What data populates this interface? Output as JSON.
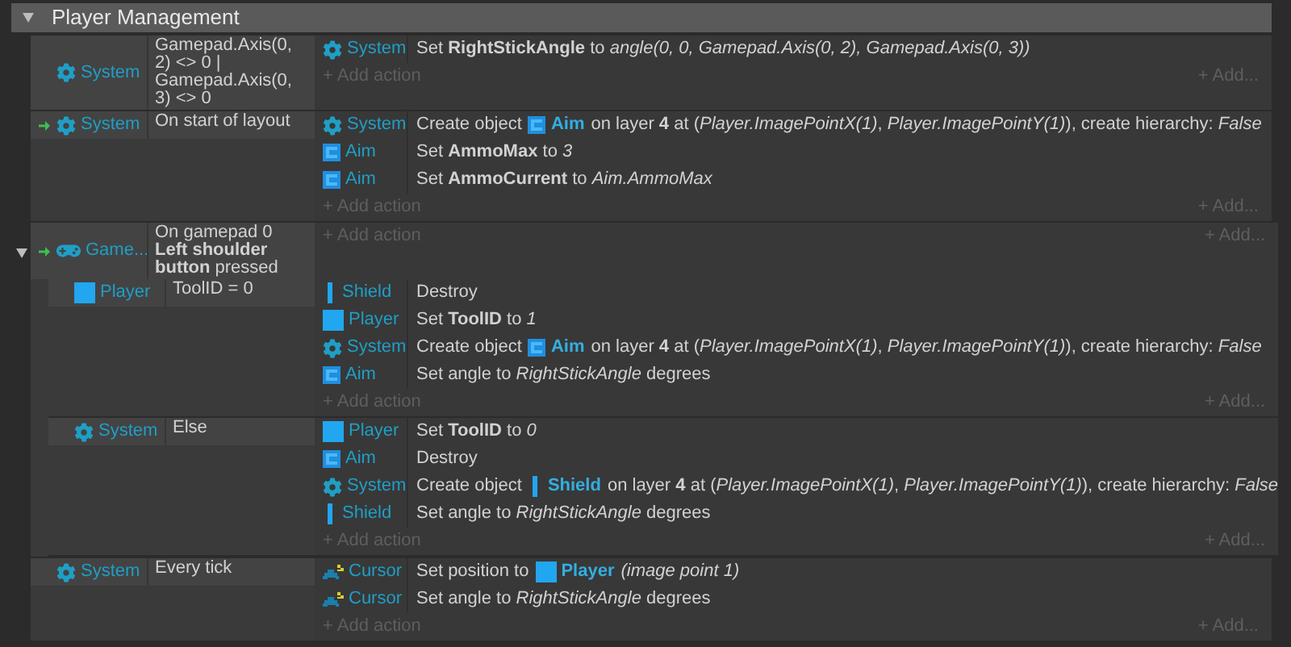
{
  "group": {
    "title": "Player Management",
    "expanded": true
  },
  "events": [
    {
      "trigger": false,
      "condition": {
        "kind": "gear",
        "object": "System",
        "text": "Gamepad.Axis(0, 2) <> 0 | Gamepad.Axis(0, 3) <> 0"
      },
      "actions": [
        {
          "kind": "gear",
          "object": "System",
          "parts": [
            {
              "kind": "text",
              "text": "Set **RightStickAngle** to *angle(0, 0, Gamepad.Axis(0, 2), Gamepad.Axis(0, 3))*"
            }
          ]
        }
      ],
      "add_action": "+ Add action",
      "add_more": "+ Add..."
    },
    {
      "trigger": true,
      "condition": {
        "kind": "gear",
        "object": "System",
        "text": "On start of layout"
      },
      "actions": [
        {
          "kind": "gear",
          "object": "System",
          "parts": [
            {
              "kind": "text",
              "text": "Create object"
            },
            {
              "kind": "aim",
              "text": "Aim"
            },
            {
              "kind": "text",
              "text": "on layer **4** at (*Player.ImagePointX(1)*, *Player.ImagePointY(1)*), create hierarchy: *False*"
            }
          ]
        },
        {
          "kind": "aim",
          "object": "Aim",
          "parts": [
            {
              "kind": "text",
              "text": "Set **AmmoMax** to *3*"
            }
          ]
        },
        {
          "kind": "aim",
          "object": "Aim",
          "parts": [
            {
              "kind": "text",
              "text": "Set **AmmoCurrent** to *Aim.AmmoMax*"
            }
          ]
        }
      ],
      "add_action": "+ Add action",
      "add_more": "+ Add..."
    },
    {
      "trigger": true,
      "expanded": true,
      "condition": {
        "kind": "gamepad",
        "object": "Game...",
        "text": "On gamepad 0 **Left shoulder button** pressed"
      },
      "add_action": "+ Add action",
      "add_more": "+ Add...",
      "children": [
        {
          "trigger": false,
          "condition": {
            "kind": "player",
            "object": "Player",
            "text": "ToolID = 0"
          },
          "actions": [
            {
              "kind": "shield",
              "object": "Shield",
              "parts": [
                {
                  "kind": "text",
                  "text": "Destroy"
                }
              ]
            },
            {
              "kind": "player",
              "object": "Player",
              "parts": [
                {
                  "kind": "text",
                  "text": "Set **ToolID** to *1*"
                }
              ]
            },
            {
              "kind": "gear",
              "object": "System",
              "parts": [
                {
                  "kind": "text",
                  "text": "Create object"
                },
                {
                  "kind": "aim",
                  "text": "Aim"
                },
                {
                  "kind": "text",
                  "text": "on layer **4** at (*Player.ImagePointX(1)*, *Player.ImagePointY(1)*), create hierarchy: *False*"
                }
              ]
            },
            {
              "kind": "aim",
              "object": "Aim",
              "parts": [
                {
                  "kind": "text",
                  "text": "Set angle to *RightStickAngle* degrees"
                }
              ]
            }
          ],
          "add_action": "+ Add action",
          "add_more": "+ Add..."
        },
        {
          "trigger": false,
          "condition": {
            "kind": "gear",
            "object": "System",
            "text": "Else"
          },
          "actions": [
            {
              "kind": "player",
              "object": "Player",
              "parts": [
                {
                  "kind": "text",
                  "text": "Set **ToolID** to *0*"
                }
              ]
            },
            {
              "kind": "aim",
              "object": "Aim",
              "parts": [
                {
                  "kind": "text",
                  "text": "Destroy"
                }
              ]
            },
            {
              "kind": "gear",
              "object": "System",
              "parts": [
                {
                  "kind": "text",
                  "text": "Create object"
                },
                {
                  "kind": "shield",
                  "text": "Shield"
                },
                {
                  "kind": "text",
                  "text": "on layer **4** at (*Player.ImagePointX(1)*, *Player.ImagePointY(1)*), create hierarchy: *False*"
                }
              ]
            },
            {
              "kind": "shield",
              "object": "Shield",
              "parts": [
                {
                  "kind": "text",
                  "text": "Set angle to *RightStickAngle* degrees"
                }
              ]
            }
          ],
          "add_action": "+ Add action",
          "add_more": "+ Add..."
        }
      ]
    },
    {
      "trigger": false,
      "condition": {
        "kind": "gear",
        "object": "System",
        "text": "Every tick"
      },
      "actions": [
        {
          "kind": "cursor",
          "object": "Cursor",
          "parts": [
            {
              "kind": "text",
              "text": "Set position to"
            },
            {
              "kind": "player",
              "text": "Player"
            },
            {
              "kind": "text",
              "text": "*(image point 1)*"
            }
          ]
        },
        {
          "kind": "cursor",
          "object": "Cursor",
          "parts": [
            {
              "kind": "text",
              "text": "Set angle to *RightStickAngle* degrees"
            }
          ]
        }
      ],
      "add_action": "+ Add action",
      "add_more": "+ Add..."
    }
  ]
}
